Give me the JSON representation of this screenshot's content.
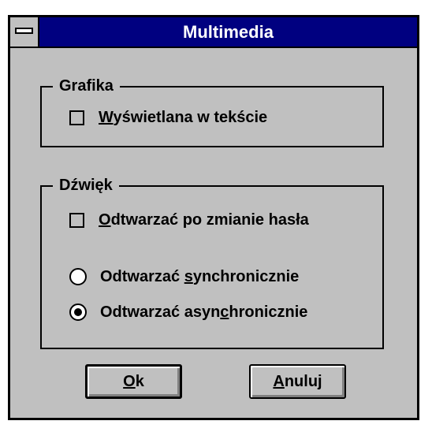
{
  "window": {
    "title": "Multimedia"
  },
  "grafika": {
    "legend": "Grafika",
    "checkbox": {
      "pre": "",
      "mnemonic": "W",
      "post": "yświetlana w tekście",
      "checked": false
    }
  },
  "dzwiek": {
    "legend": "Dźwięk",
    "checkbox": {
      "pre": "",
      "mnemonic": "O",
      "post": "dtwarzać po zmianie hasła",
      "checked": false
    },
    "radio_sync": {
      "pre": "Odtwarzać ",
      "mnemonic": "s",
      "post": "ynchronicznie",
      "selected": false
    },
    "radio_async": {
      "pre": "Odtwarzać asyn",
      "mnemonic": "c",
      "post": "hronicznie",
      "selected": true
    }
  },
  "buttons": {
    "ok": {
      "pre": "",
      "mnemonic": "O",
      "post": "k"
    },
    "cancel": {
      "pre": "",
      "mnemonic": "A",
      "post": "nuluj"
    }
  }
}
